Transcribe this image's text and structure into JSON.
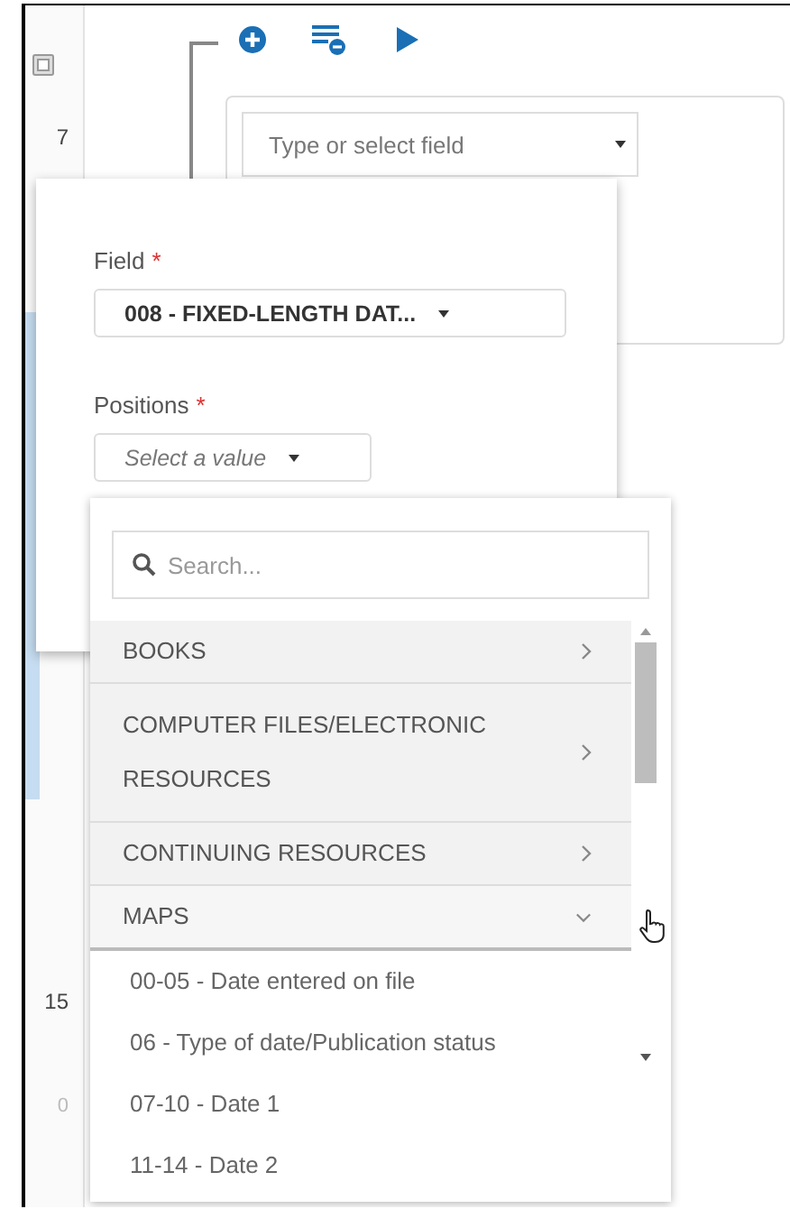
{
  "gutter": {
    "line_numbers": [
      "7",
      "15",
      "0"
    ]
  },
  "rule_card": {
    "field_placeholder": "Type or select field"
  },
  "field_popup": {
    "required_mark": "*",
    "field": {
      "label": "Field",
      "required": true,
      "value": "008 - FIXED-LENGTH DAT..."
    },
    "positions": {
      "label": "Positions",
      "required": true,
      "placeholder": "Select a value"
    }
  },
  "positions_dropdown": {
    "search_placeholder": "Search...",
    "groups": [
      {
        "label": "BOOKS",
        "expanded": false
      },
      {
        "label": "COMPUTER FILES/ELECTRONIC RESOURCES",
        "expanded": false
      },
      {
        "label": "CONTINUING RESOURCES",
        "expanded": false
      },
      {
        "label": "MAPS",
        "expanded": true,
        "children": [
          "00-05 - Date entered on file",
          "06 - Type of date/Publication status",
          "07-10 - Date 1",
          "11-14 - Date 2"
        ]
      }
    ]
  }
}
